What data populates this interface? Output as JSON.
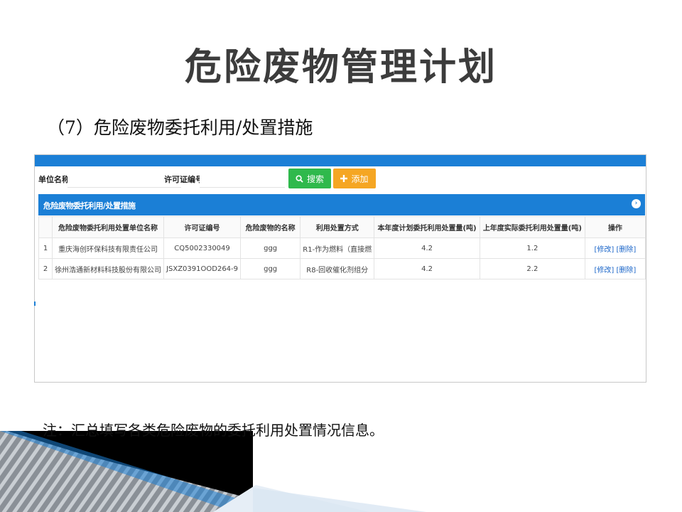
{
  "slide": {
    "title": "危险废物管理计划",
    "subtitle": "（7）危险废物委托利用/处置措施",
    "note": "注：汇总填写各类危险废物的委托利用处置情况信息。"
  },
  "search": {
    "unit_label": "单位名称:",
    "unit_value": "",
    "permit_label": "许可证编号:",
    "permit_value": "",
    "search_button": "搜索",
    "add_button": "添加"
  },
  "section": {
    "title": "危险废物委托利用/处置措施",
    "collapse_icon": "collapse-icon"
  },
  "table": {
    "headers": [
      "",
      "危险废物委托利用处置单位名称",
      "许可证编号",
      "危险废物的名称",
      "利用处置方式",
      "本年度计划委托利用处置量(吨)",
      "上年度实际委托利用处置量(吨)",
      "操作"
    ],
    "rows": [
      {
        "index": "1",
        "unit": "重庆海创环保科技有限责任公司",
        "permit": "CQ5002330049",
        "waste": "ggg",
        "method": "R1-作为燃料（直接燃",
        "plan": "4.2",
        "actual": "1.2",
        "edit": "[修改]",
        "delete": "[删除]"
      },
      {
        "index": "2",
        "unit": "徐州浩通新材料科技股份有限公司",
        "permit": "JSXZ0391OOD264-9",
        "waste": "ggg",
        "method": "R8-回收催化剂组分",
        "plan": "4.2",
        "actual": "2.2",
        "edit": "[修改]",
        "delete": "[删除]"
      }
    ]
  },
  "colors": {
    "accent": "#1b7fd6",
    "search_green": "#2fb94c",
    "add_orange": "#f5a623",
    "link_blue": "#1b66c9"
  }
}
